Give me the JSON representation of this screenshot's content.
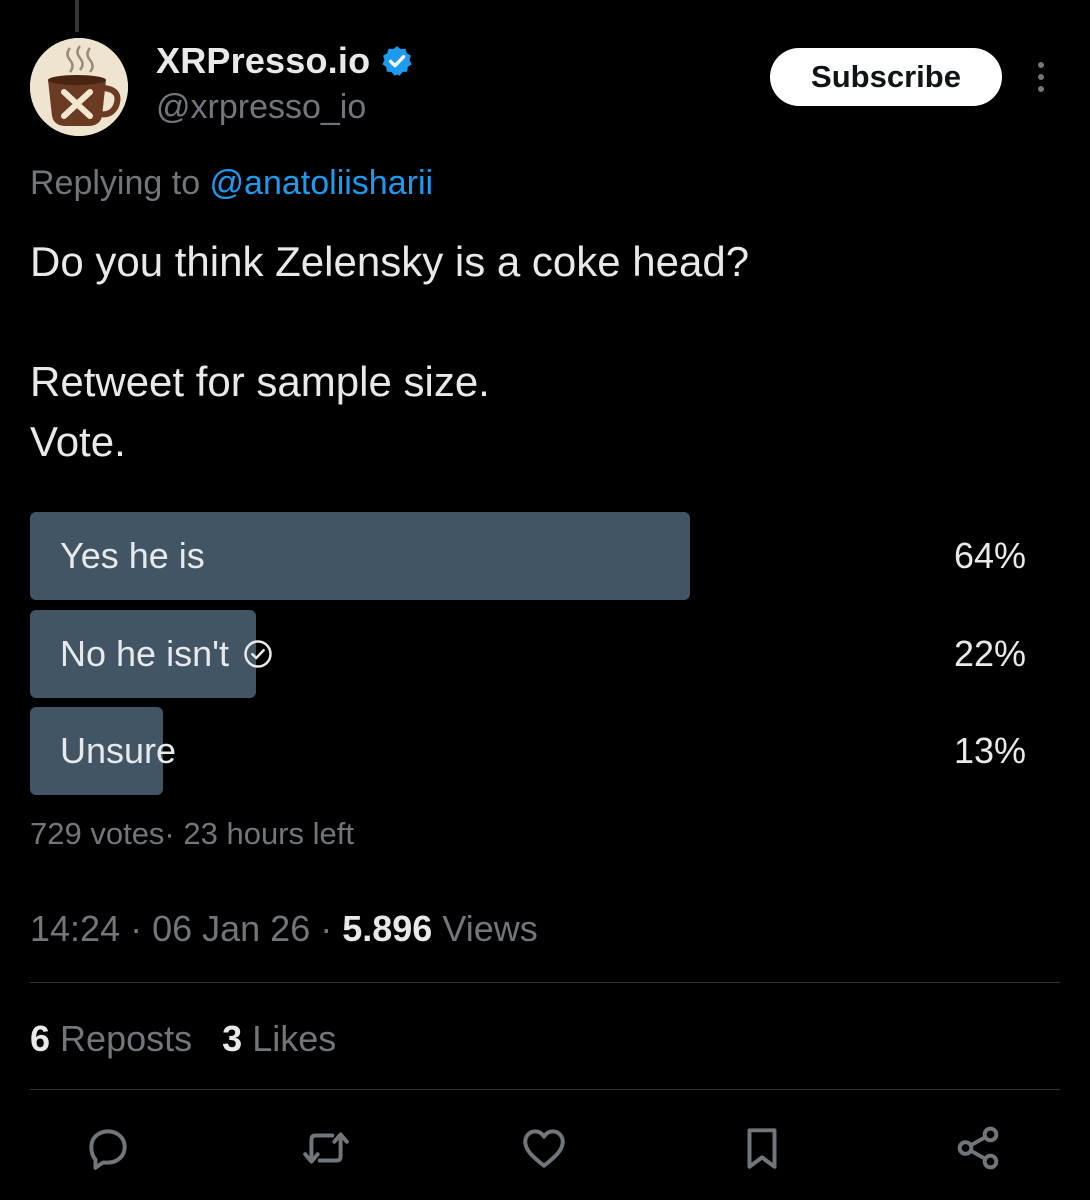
{
  "author": {
    "display_name": "XRPresso.io",
    "handle": "@xrpresso_io",
    "verified_icon": "verified-badge-icon"
  },
  "header": {
    "subscribe_label": "Subscribe",
    "more_icon": "more-options-icon"
  },
  "reply": {
    "prefix": "Replying to ",
    "mention": "@anatoliisharii"
  },
  "tweet": {
    "line1": "Do you think Zelensky is a coke head?",
    "line2": "Retweet for sample size.",
    "line3": "Vote."
  },
  "poll": {
    "options": [
      {
        "label": "Yes he is",
        "percent_text": "64%",
        "fill_fraction": 0.66,
        "voted": false
      },
      {
        "label": "No he isn't",
        "percent_text": "22%",
        "fill_fraction": 0.226,
        "voted": true
      },
      {
        "label": "Unsure",
        "percent_text": "13%",
        "fill_fraction": 0.133,
        "voted": false
      }
    ],
    "meta": "729 votes· 23 hours left"
  },
  "timestamp": {
    "time": "14:24",
    "date": "06 Jan 26",
    "views_count": "5.896",
    "views_label": "Views"
  },
  "stats": {
    "reposts_count": "6",
    "reposts_label": "Reposts",
    "likes_count": "3",
    "likes_label": "Likes"
  },
  "colors": {
    "background": "#000000",
    "poll_bar": "#425565",
    "accent": "#1d9bf0",
    "muted_text": "#71767b"
  }
}
